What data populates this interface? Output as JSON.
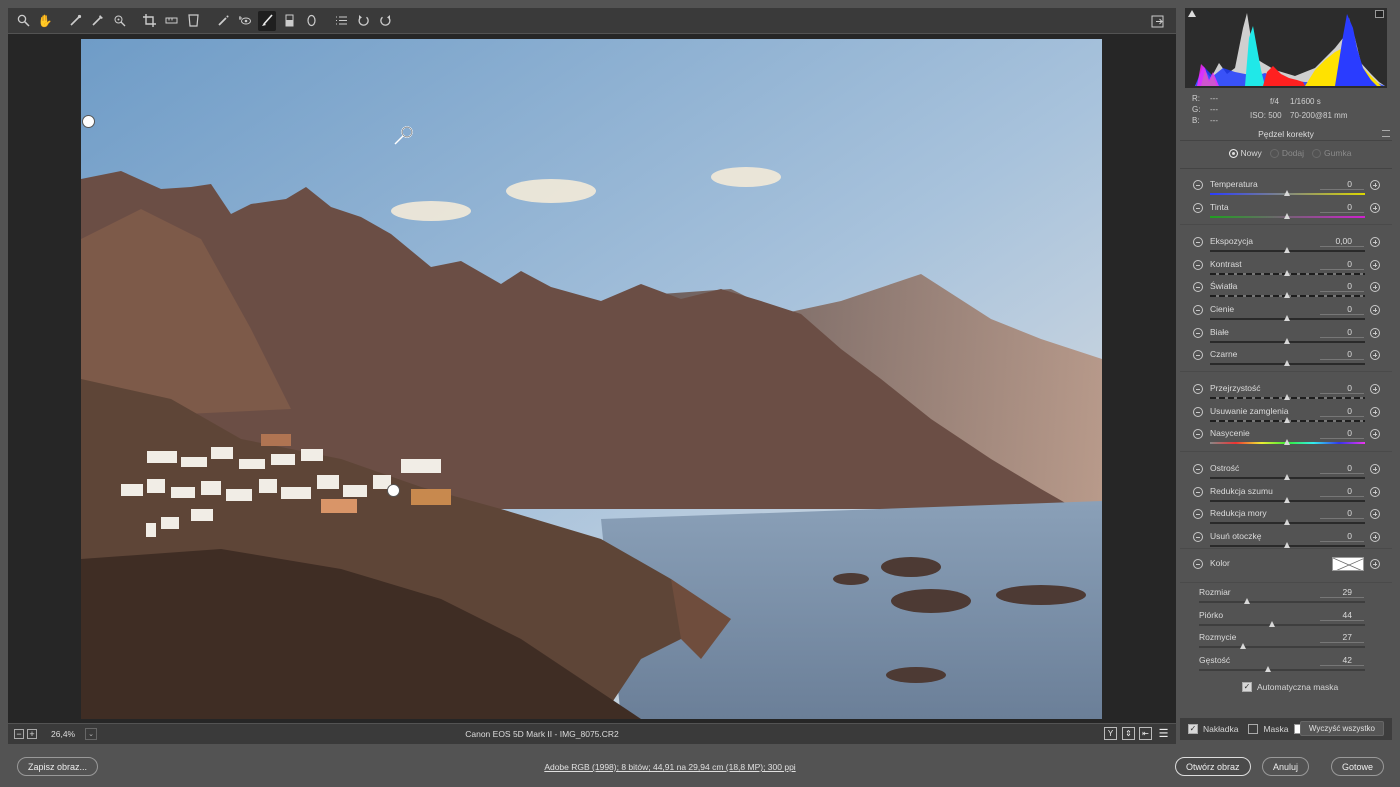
{
  "toolbar": {
    "tools": [
      "zoom-icon",
      "hand-icon",
      "white-balance-icon",
      "color-sampler-icon",
      "target-adjustment-icon",
      "crop-icon",
      "straighten-icon",
      "transform-icon",
      "spot-removal-icon",
      "red-eye-icon",
      "adjustment-brush-icon",
      "graduated-filter-icon",
      "radial-filter-icon",
      "preferences-icon",
      "rotate-left-icon",
      "rotate-right-icon"
    ],
    "active_tool": "adjustment-brush-icon",
    "export_icon": "open-preferences-icon"
  },
  "status": {
    "zoom": "26,4%",
    "file": "Canon EOS 5D Mark II  -  IMG_8075.CR2",
    "view_buttons": [
      "Y"
    ]
  },
  "histogram": {
    "rgb": {
      "r": "R:",
      "g": "G:",
      "b": "B:",
      "r_val": "---",
      "g_val": "---",
      "b_val": "---"
    },
    "aperture": "f/4",
    "shutter": "1/1600 s",
    "iso": "ISO: 500",
    "lens": "70-200@81 mm"
  },
  "tool_panel": {
    "title": "Pędzel korekty",
    "modes": {
      "new": "Nowy",
      "add": "Dodaj",
      "erase": "Gumka"
    },
    "sliders": [
      {
        "label": "Temperatura",
        "value": "0"
      },
      {
        "label": "Tinta",
        "value": "0"
      },
      {
        "label": "Ekspozycja",
        "value": "0,00"
      },
      {
        "label": "Kontrast",
        "value": "0"
      },
      {
        "label": "Światła",
        "value": "0"
      },
      {
        "label": "Cienie",
        "value": "0"
      },
      {
        "label": "Białe",
        "value": "0"
      },
      {
        "label": "Czarne",
        "value": "0"
      },
      {
        "label": "Przejrzystość",
        "value": "0"
      },
      {
        "label": "Usuwanie zamglenia",
        "value": "0"
      },
      {
        "label": "Nasycenie",
        "value": "0"
      },
      {
        "label": "Ostrość",
        "value": "0"
      },
      {
        "label": "Redukcja szumu",
        "value": "0"
      },
      {
        "label": "Redukcja mory",
        "value": "0"
      },
      {
        "label": "Usuń otoczkę",
        "value": "0"
      }
    ],
    "color_label": "Kolor",
    "brush": [
      {
        "label": "Rozmiar",
        "value": "29"
      },
      {
        "label": "Piórko",
        "value": "44"
      },
      {
        "label": "Rozmycie",
        "value": "27"
      },
      {
        "label": "Gęstość",
        "value": "42"
      }
    ],
    "brush_levels": [
      0.29,
      0.44,
      0.27,
      0.42
    ],
    "auto_mask": "Automatyczna maska"
  },
  "overlay_bar": {
    "overlay": "Nakładka",
    "mask": "Maska",
    "clear": "Wyczyść wszystko"
  },
  "bottom": {
    "save": "Zapisz obraz...",
    "info": "Adobe RGB (1998); 8 bitów; 44,91 na 29,94 cm (18,8 MP); 300 ppi",
    "open": "Otwórz obraz",
    "cancel": "Anuluj",
    "done": "Gotowe"
  }
}
